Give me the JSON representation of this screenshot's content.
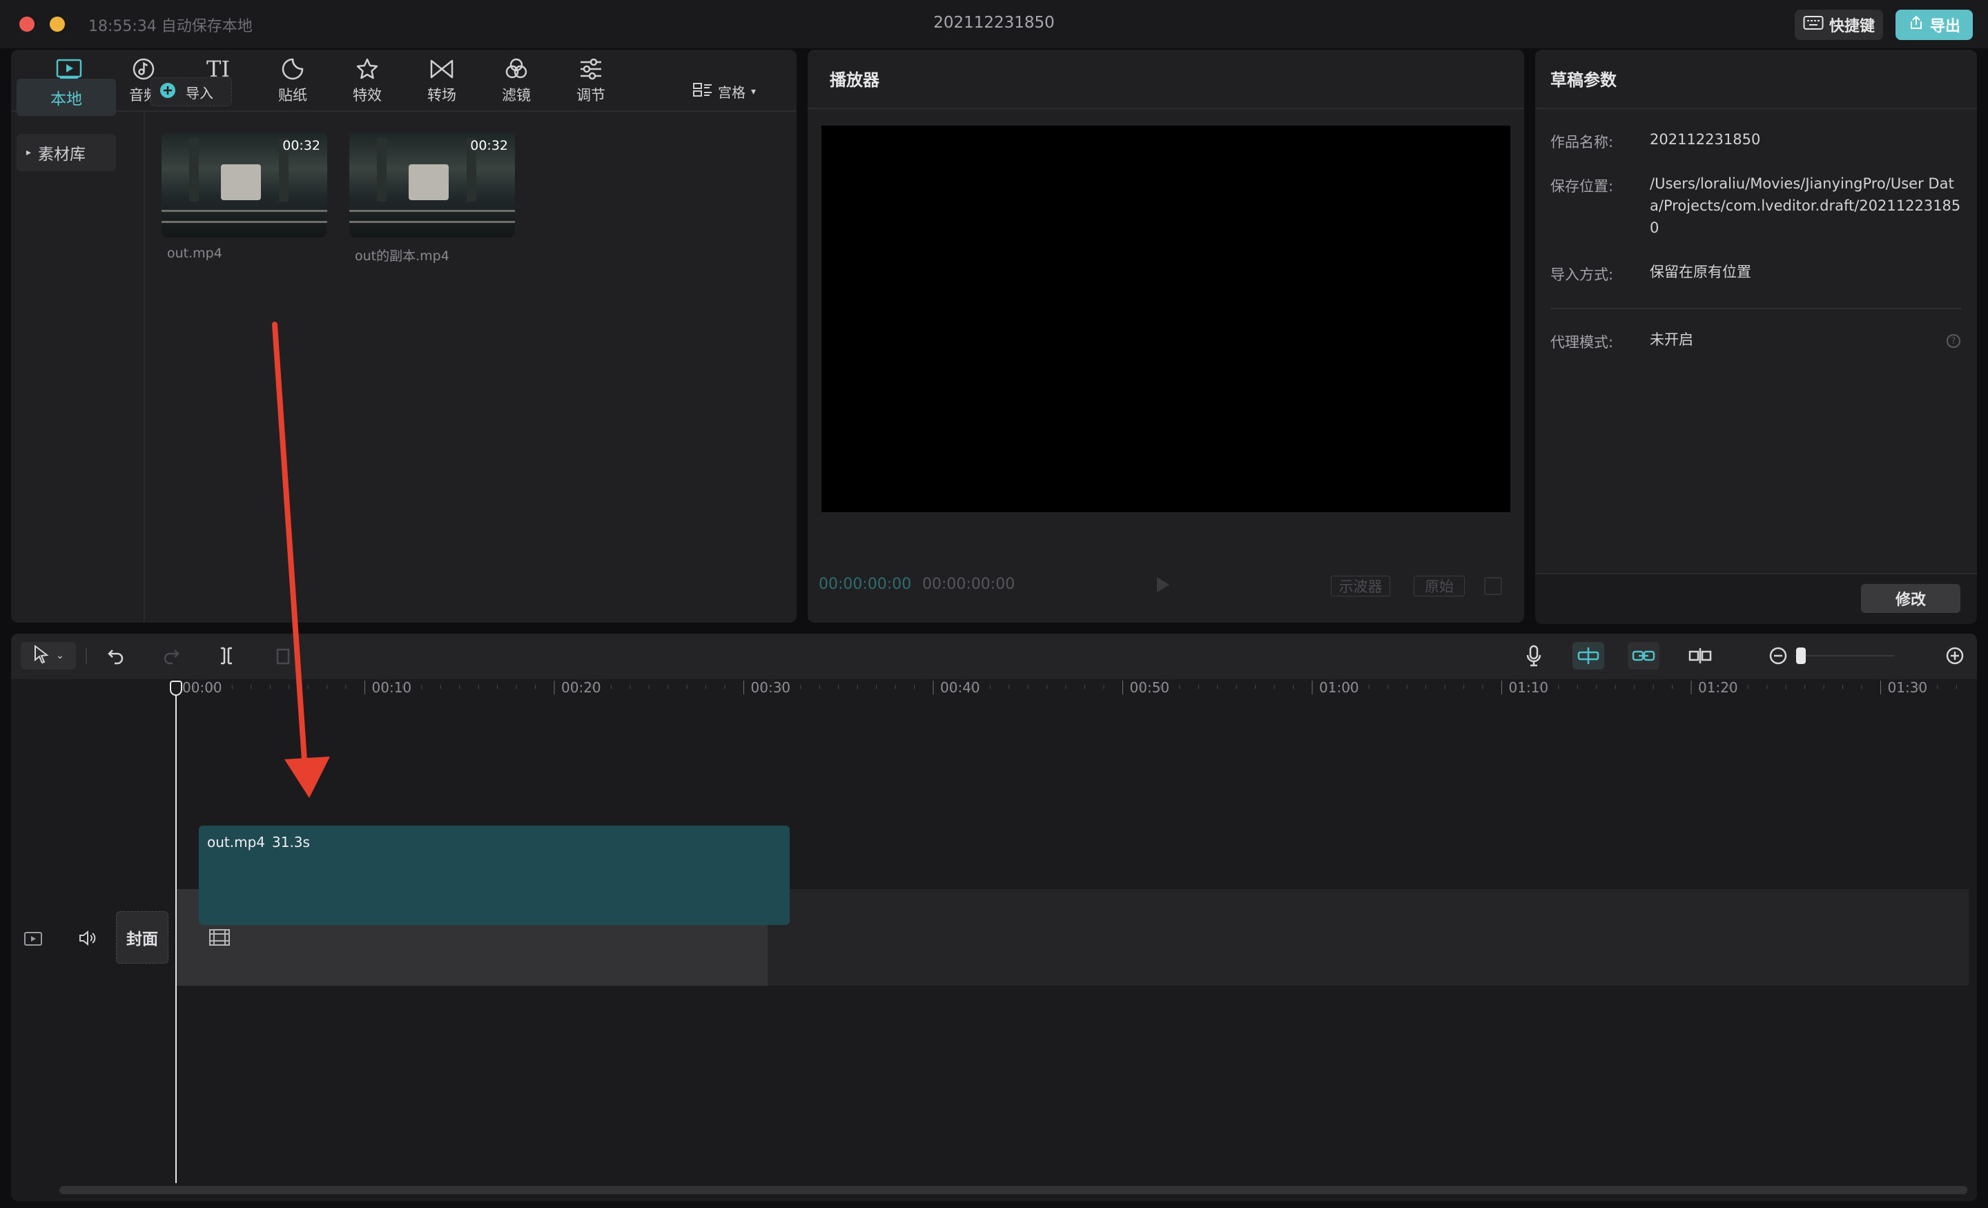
{
  "titlebar": {
    "autosave": "18:55:34 自动保存本地",
    "title": "202112231850",
    "shortcut_label": "快捷键",
    "export_label": "导出"
  },
  "media_tabs": [
    {
      "label": "媒体",
      "icon": "media-play-icon",
      "active": true
    },
    {
      "label": "音频",
      "icon": "audio-note-icon"
    },
    {
      "label": "文本",
      "icon": "text-icon",
      "glyph": "TI"
    },
    {
      "label": "贴纸",
      "icon": "sticker-icon"
    },
    {
      "label": "特效",
      "icon": "effects-star-icon"
    },
    {
      "label": "转场",
      "icon": "transition-bowtie-icon"
    },
    {
      "label": "滤镜",
      "icon": "filter-circles-icon"
    },
    {
      "label": "调节",
      "icon": "adjust-sliders-icon"
    }
  ],
  "media_side": {
    "local": "本地",
    "library": "素材库"
  },
  "import_label": "导入",
  "view_label": "宫格",
  "media_items": [
    {
      "name": "out.mp4",
      "duration": "00:32"
    },
    {
      "name": "out的副本.mp4",
      "duration": "00:32"
    }
  ],
  "player": {
    "title": "播放器",
    "current_time": "00:00:00:00",
    "total_time": "00:00:00:00",
    "waveform_btn": "示波器",
    "original_btn": "原始"
  },
  "draft_params": {
    "title": "草稿参数",
    "name_label": "作品名称:",
    "name_value": "202112231850",
    "location_label": "保存位置:",
    "location_value": "/Users/loraliu/Movies/JianyingPro/User Data/Projects/com.lveditor.draft/202112231850",
    "import_label": "导入方式:",
    "import_value": "保留在原有位置",
    "proxy_label": "代理模式:",
    "proxy_value": "未开启",
    "modify_label": "修改"
  },
  "ruler_labels": [
    "00:00",
    "00:10",
    "00:20",
    "00:30",
    "00:40",
    "00:50",
    "01:00",
    "01:10",
    "01:20",
    "01:30"
  ],
  "timeline": {
    "clip_name": "out.mp4",
    "clip_duration": "31.3s",
    "cover_label": "封面"
  },
  "colors": {
    "accent": "#4fc3cc",
    "export_bg": "#5fc1c8",
    "clip_bg": "#1f4a52",
    "arrow": "#e8402f"
  }
}
